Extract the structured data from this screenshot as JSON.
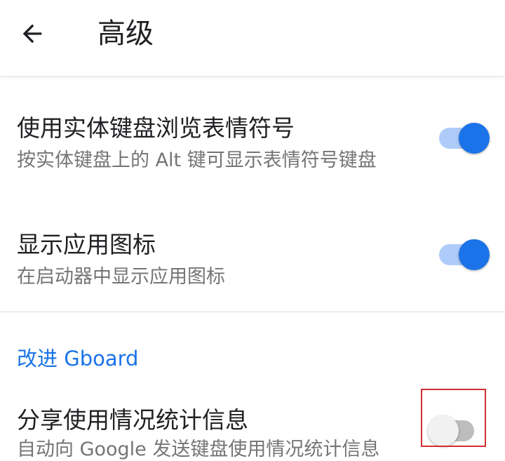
{
  "appbar": {
    "title": "高级",
    "back_icon": "arrow-back-icon"
  },
  "settings": [
    {
      "title": "使用实体键盘浏览表情符号",
      "summary": "按实体键盘上的 Alt 键可显示表情符号键盘",
      "enabled": true
    },
    {
      "title": "显示应用图标",
      "summary": "在启动器中显示应用图标",
      "enabled": true
    }
  ],
  "section": {
    "header": "改进 Gboard",
    "item": {
      "title": "分享使用情况统计信息",
      "summary": "自动向 Google 发送键盘使用情况统计信息",
      "enabled": false
    }
  },
  "colors": {
    "accent": "#1a73e8",
    "switch_on_track": "#aecbfa",
    "switch_off_track": "#bdbdbd",
    "highlight": "#d32f2f"
  }
}
